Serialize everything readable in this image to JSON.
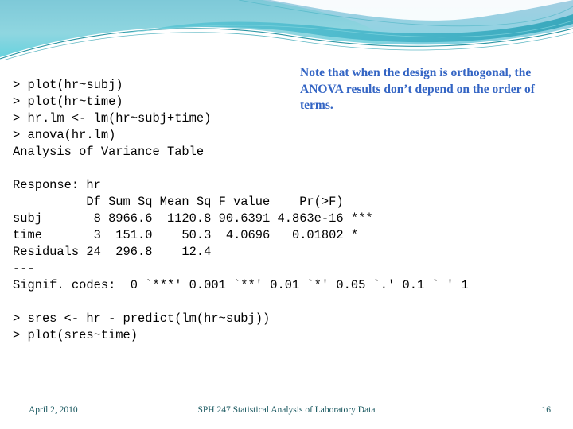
{
  "header": {
    "decoration": "teal-wave-banner",
    "colors": {
      "teal_light": "#9fe0e6",
      "teal_mid": "#5fc8d6",
      "teal_deep": "#2fa3b8",
      "teal_line": "#1f8f9e",
      "blue_tint": "#a9cfe4",
      "white": "#ffffff"
    }
  },
  "console": {
    "lines": [
      "> plot(hr~subj)",
      "> plot(hr~time)",
      "> hr.lm <- lm(hr~subj+time)",
      "> anova(hr.lm)",
      "Analysis of Variance Table",
      "",
      "Response: hr",
      "          Df Sum Sq Mean Sq F value    Pr(>F)",
      "subj       8 8966.6  1120.8 90.6391 4.863e-16 ***",
      "time       3  151.0    50.3  4.0696   0.01802 *",
      "Residuals 24  296.8    12.4",
      "---",
      "Signif. codes:  0 `***' 0.001 `**' 0.01 `*' 0.05 `.' 0.1 ` ' 1",
      "",
      "> sres <- hr - predict(lm(hr~subj))",
      "> plot(sres~time)"
    ]
  },
  "anova_table": {
    "title": "Analysis of Variance Table",
    "response": "hr",
    "columns": [
      "",
      "Df",
      "Sum Sq",
      "Mean Sq",
      "F value",
      "Pr(>F)",
      "signif"
    ],
    "rows": [
      {
        "term": "subj",
        "df": "8",
        "sum_sq": "8966.6",
        "mean_sq": "1120.8",
        "f_value": "90.6391",
        "pr_gt_f": "4.863e-16",
        "signif": "***"
      },
      {
        "term": "time",
        "df": "3",
        "sum_sq": "151.0",
        "mean_sq": "50.3",
        "f_value": "4.0696",
        "pr_gt_f": "0.01802",
        "signif": "*"
      },
      {
        "term": "Residuals",
        "df": "24",
        "sum_sq": "296.8",
        "mean_sq": "12.4",
        "f_value": "",
        "pr_gt_f": "",
        "signif": ""
      }
    ],
    "signif_codes": "Signif. codes:  0 `***' 0.001 `**' 0.01 `*' 0.05 `.' 0.1 ` ' 1"
  },
  "note": {
    "text": "Note that when the design is orthogonal, the ANOVA results don’t depend on the order of terms.",
    "color": "#3465c4"
  },
  "footer": {
    "date": "April 2, 2010",
    "title": "SPH 247 Statistical Analysis of Laboratory Data",
    "page_number": "16",
    "color": "#14545c"
  }
}
